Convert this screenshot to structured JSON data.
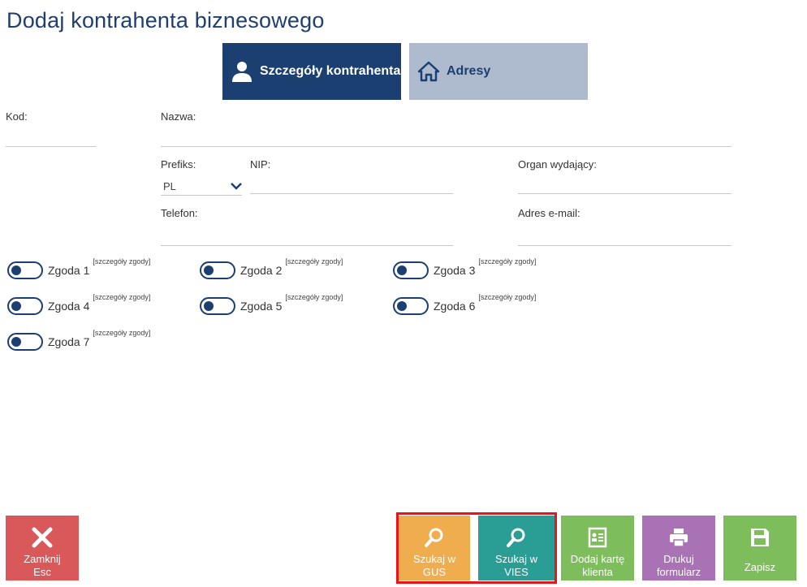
{
  "page": {
    "title": "Dodaj kontrahenta biznesowego"
  },
  "tabs": [
    {
      "label": "Szczegóły kontrahenta",
      "icon": "user-icon",
      "active": true
    },
    {
      "label": "Adresy",
      "icon": "home-icon",
      "active": false
    }
  ],
  "form": {
    "kod": {
      "label": "Kod:",
      "value": ""
    },
    "nazwa": {
      "label": "Nazwa:",
      "value": ""
    },
    "prefiks": {
      "label": "Prefiks:",
      "value": "PL"
    },
    "nip": {
      "label": "NIP:",
      "value": ""
    },
    "organ": {
      "label": "Organ wydający:",
      "value": ""
    },
    "telefon": {
      "label": "Telefon:",
      "value": ""
    },
    "email": {
      "label": "Adres e-mail:",
      "value": ""
    }
  },
  "consents": [
    {
      "label": "Zgoda 1",
      "details": "[szczegóły zgody]"
    },
    {
      "label": "Zgoda 2",
      "details": "[szczegóły zgody]"
    },
    {
      "label": "Zgoda 3",
      "details": "[szczegóły zgody]"
    },
    {
      "label": "Zgoda 4",
      "details": "[szczegóły zgody]"
    },
    {
      "label": "Zgoda 5",
      "details": "[szczegóły zgody]"
    },
    {
      "label": "Zgoda 6",
      "details": "[szczegóły zgody]"
    },
    {
      "label": "Zgoda 7",
      "details": "[szczegóły zgody]"
    }
  ],
  "buttons": {
    "close": {
      "line1": "Zamknij",
      "line2": "Esc"
    },
    "gus": {
      "line1": "Szukaj w",
      "line2": "GUS"
    },
    "vies": {
      "line1": "Szukaj w",
      "line2": "VIES"
    },
    "card": {
      "line1": "Dodaj kartę",
      "line2": "klienta"
    },
    "print": {
      "line1": "Drukuj",
      "line2": "formularz"
    },
    "save": {
      "line1": "Zapisz"
    }
  },
  "colors": {
    "primary": "#1c3f71",
    "tab_inactive": "#aebbcf",
    "close": "#d9585a",
    "gus": "#f0ad4e",
    "vies": "#2a9d94",
    "green": "#7dbd5b",
    "purple": "#a872b4",
    "highlight": "#e8141a"
  }
}
